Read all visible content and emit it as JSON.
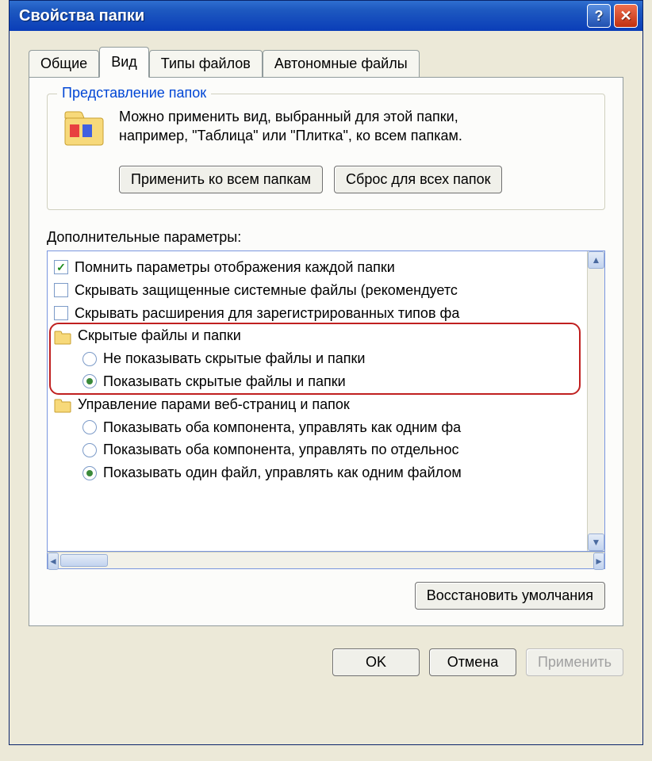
{
  "title": "Свойства папки",
  "tabs": [
    {
      "label": "Общие"
    },
    {
      "label": "Вид"
    },
    {
      "label": "Типы файлов"
    },
    {
      "label": "Автономные файлы"
    }
  ],
  "active_tab_index": 1,
  "groupbox": {
    "title": "Представление папок",
    "text_line1": "Можно применить вид, выбранный для этой папки,",
    "text_line2": "например, \"Таблица\" или \"Плитка\", ко всем папкам.",
    "apply_all_label": "Применить ко всем папкам",
    "reset_all_label": "Сброс для всех папок"
  },
  "advanced_label": "Дополнительные параметры:",
  "tree": [
    {
      "type": "checkbox",
      "checked": true,
      "label": "Помнить параметры отображения каждой папки"
    },
    {
      "type": "checkbox",
      "checked": false,
      "label": "Скрывать защищенные системные файлы (рекомендуетс"
    },
    {
      "type": "checkbox",
      "checked": false,
      "label": "Скрывать расширения для зарегистрированных типов фа"
    },
    {
      "type": "folder",
      "label": "Скрытые файлы и папки"
    },
    {
      "type": "radio",
      "selected": false,
      "indent": true,
      "label": "Не показывать скрытые файлы и папки"
    },
    {
      "type": "radio",
      "selected": true,
      "indent": true,
      "label": "Показывать скрытые файлы и папки"
    },
    {
      "type": "folder",
      "label": "Управление парами веб-страниц и папок"
    },
    {
      "type": "radio",
      "selected": false,
      "indent": true,
      "label": "Показывать оба компонента, управлять как одним фа"
    },
    {
      "type": "radio",
      "selected": false,
      "indent": true,
      "label": "Показывать оба компонента, управлять по отдельнос"
    },
    {
      "type": "radio",
      "selected": true,
      "indent": true,
      "label": "Показывать один файл, управлять как одним файлом"
    }
  ],
  "highlight_rows": {
    "start": 3,
    "end": 5
  },
  "restore_defaults_label": "Восстановить умолчания",
  "buttons": {
    "ok": "OK",
    "cancel": "Отмена",
    "apply": "Применить"
  }
}
